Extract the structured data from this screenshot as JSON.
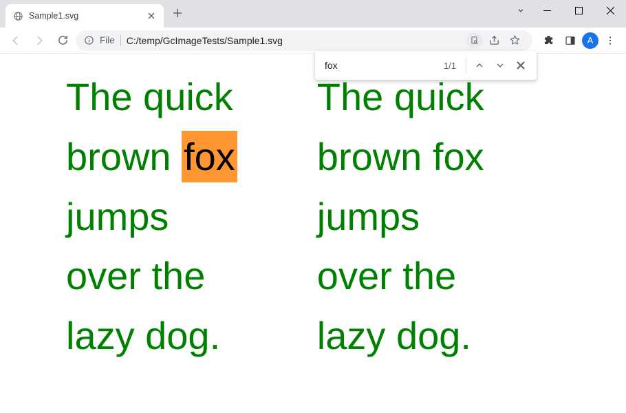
{
  "tab": {
    "title": "Sample1.svg"
  },
  "omnibox": {
    "scheme_label": "File",
    "path": "C:/temp/GcImageTests/Sample1.svg"
  },
  "avatar": {
    "initial": "A"
  },
  "findbar": {
    "query": "fox",
    "count": "1/1"
  },
  "page": {
    "col1": {
      "line1": "The quick",
      "line2_pre": "brown ",
      "line2_hl": "fox",
      "line3": "jumps",
      "line4": "over the",
      "line5": "lazy dog."
    },
    "col2": {
      "line1": "The quick",
      "line2": "brown fox",
      "line3": "jumps",
      "line4": "over the",
      "line5": "lazy dog."
    }
  }
}
